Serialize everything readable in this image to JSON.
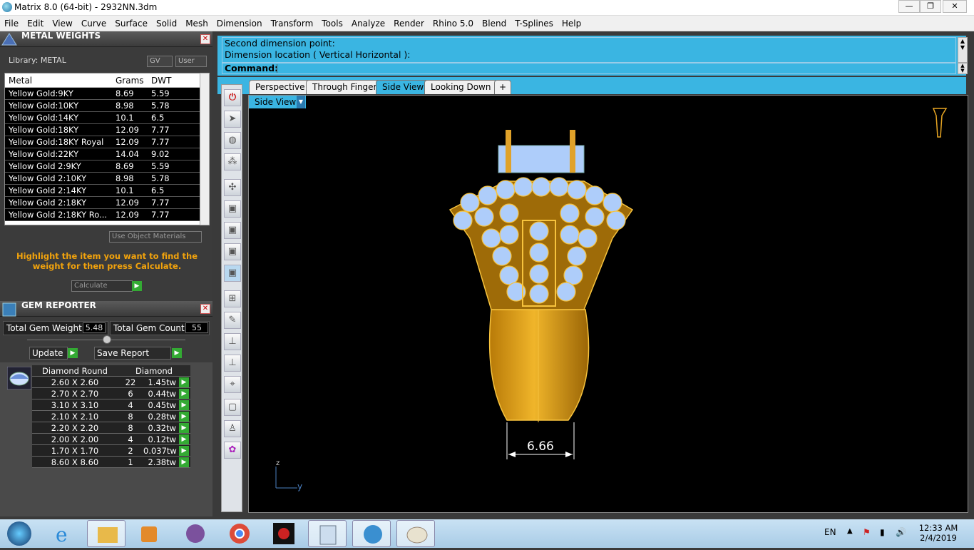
{
  "window": {
    "title": "Matrix 8.0 (64-bit) - 2932NN.3dm",
    "minimize": "—",
    "restore": "❐",
    "close": "✕"
  },
  "menu": [
    "File",
    "Edit",
    "View",
    "Curve",
    "Surface",
    "Solid",
    "Mesh",
    "Dimension",
    "Transform",
    "Tools",
    "Analyze",
    "Render",
    "Rhino 5.0",
    "Blend",
    "T-Splines",
    "Help"
  ],
  "metal_weights": {
    "title": "METAL WEIGHTS",
    "library_label": "Library: METAL",
    "gv_label": "GV",
    "user_label": "User",
    "columns": [
      "Metal",
      "Grams",
      "DWT"
    ],
    "rows": [
      [
        "Yellow Gold:9KY",
        "8.69",
        "5.59"
      ],
      [
        "Yellow Gold:10KY",
        "8.98",
        "5.78"
      ],
      [
        "Yellow Gold:14KY",
        "10.1",
        "6.5"
      ],
      [
        "Yellow Gold:18KY",
        "12.09",
        "7.77"
      ],
      [
        "Yellow Gold:18KY Royal",
        "12.09",
        "7.77"
      ],
      [
        "Yellow Gold:22KY",
        "14.04",
        "9.02"
      ],
      [
        "Yellow Gold 2:9KY",
        "8.69",
        "5.59"
      ],
      [
        "Yellow Gold 2:10KY",
        "8.98",
        "5.78"
      ],
      [
        "Yellow Gold 2:14KY",
        "10.1",
        "6.5"
      ],
      [
        "Yellow Gold 2:18KY",
        "12.09",
        "7.77"
      ],
      [
        "Yellow Gold 2:18KY Ro...",
        "12.09",
        "7.77"
      ]
    ],
    "use_object_materials": "Use Object Materials",
    "message": "Highlight the item you want to find the weight for then press Calculate.",
    "calculate_label": "Calculate"
  },
  "gem_reporter": {
    "title": "GEM REPORTER",
    "total_weight_label": "Total Gem Weight",
    "total_weight_value": "5.48",
    "total_count_label": "Total Gem Count",
    "total_count_value": "55",
    "update_label": "Update",
    "save_report_label": "Save Report",
    "columns": [
      "Diamond Round",
      "Diamond"
    ],
    "rows": [
      [
        "2.60 X 2.60",
        "22",
        "1.45tw"
      ],
      [
        "2.70 X 2.70",
        "6",
        "0.44tw"
      ],
      [
        "3.10 X 3.10",
        "4",
        "0.45tw"
      ],
      [
        "2.10 X 2.10",
        "8",
        "0.28tw"
      ],
      [
        "2.20 X 2.20",
        "8",
        "0.32tw"
      ],
      [
        "2.00 X 2.00",
        "4",
        "0.12tw"
      ],
      [
        "1.70 X 1.70",
        "2",
        "0.037tw"
      ],
      [
        "8.60 X 8.60",
        "1",
        "2.38tw"
      ]
    ]
  },
  "command": {
    "line1": "Second dimension point:",
    "line2": "Dimension location ( Vertical  Horizontal ):",
    "prompt": "Command:"
  },
  "viewport_tabs": [
    "Perspective",
    "Through Finger",
    "Side View",
    "Looking Down"
  ],
  "active_tab": "Side View",
  "add_tab": "+",
  "viewport": {
    "label": "Side View",
    "dimension_value": "6.66",
    "axis_z": "z",
    "axis_y": "y"
  },
  "taskbar": {
    "language": "EN",
    "time": "12:33 AM",
    "date": "2/4/2019"
  },
  "colors": {
    "accent": "#3ab5e2",
    "gold": "#f2a30c",
    "gem": "#aecdfa"
  }
}
